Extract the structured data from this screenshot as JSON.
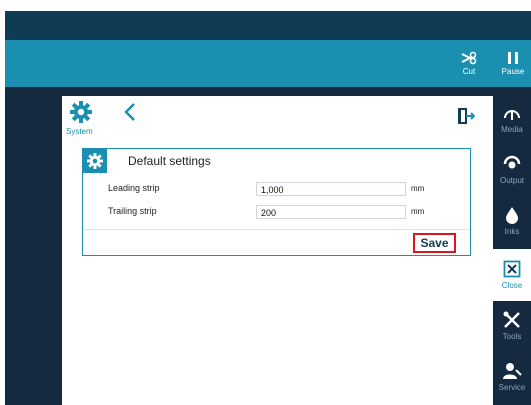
{
  "toolbar": {
    "cut_label": "Cut",
    "pause_label": "Pause"
  },
  "panel": {
    "system_label": "System",
    "card": {
      "title": "Default settings",
      "rows": [
        {
          "label": "Leading strip",
          "value": "1,000",
          "unit": "mm"
        },
        {
          "label": "Trailing strip",
          "value": "200",
          "unit": "mm"
        }
      ],
      "save_label": "Save"
    }
  },
  "sidebar": {
    "items": [
      {
        "label": "Media",
        "icon": "media-icon"
      },
      {
        "label": "Output",
        "icon": "output-icon"
      },
      {
        "label": "Inks",
        "icon": "ink-drop-icon"
      },
      {
        "label": "Close",
        "icon": "close-icon"
      },
      {
        "label": "Tools",
        "icon": "tools-icon"
      },
      {
        "label": "Service",
        "icon": "service-icon"
      }
    ]
  },
  "colors": {
    "top_band": "#0f3b55",
    "toolbar": "#1a8fb0",
    "background_dark": "#152a40",
    "accent": "#1a8fb0",
    "save_highlight": "#e0141e"
  }
}
